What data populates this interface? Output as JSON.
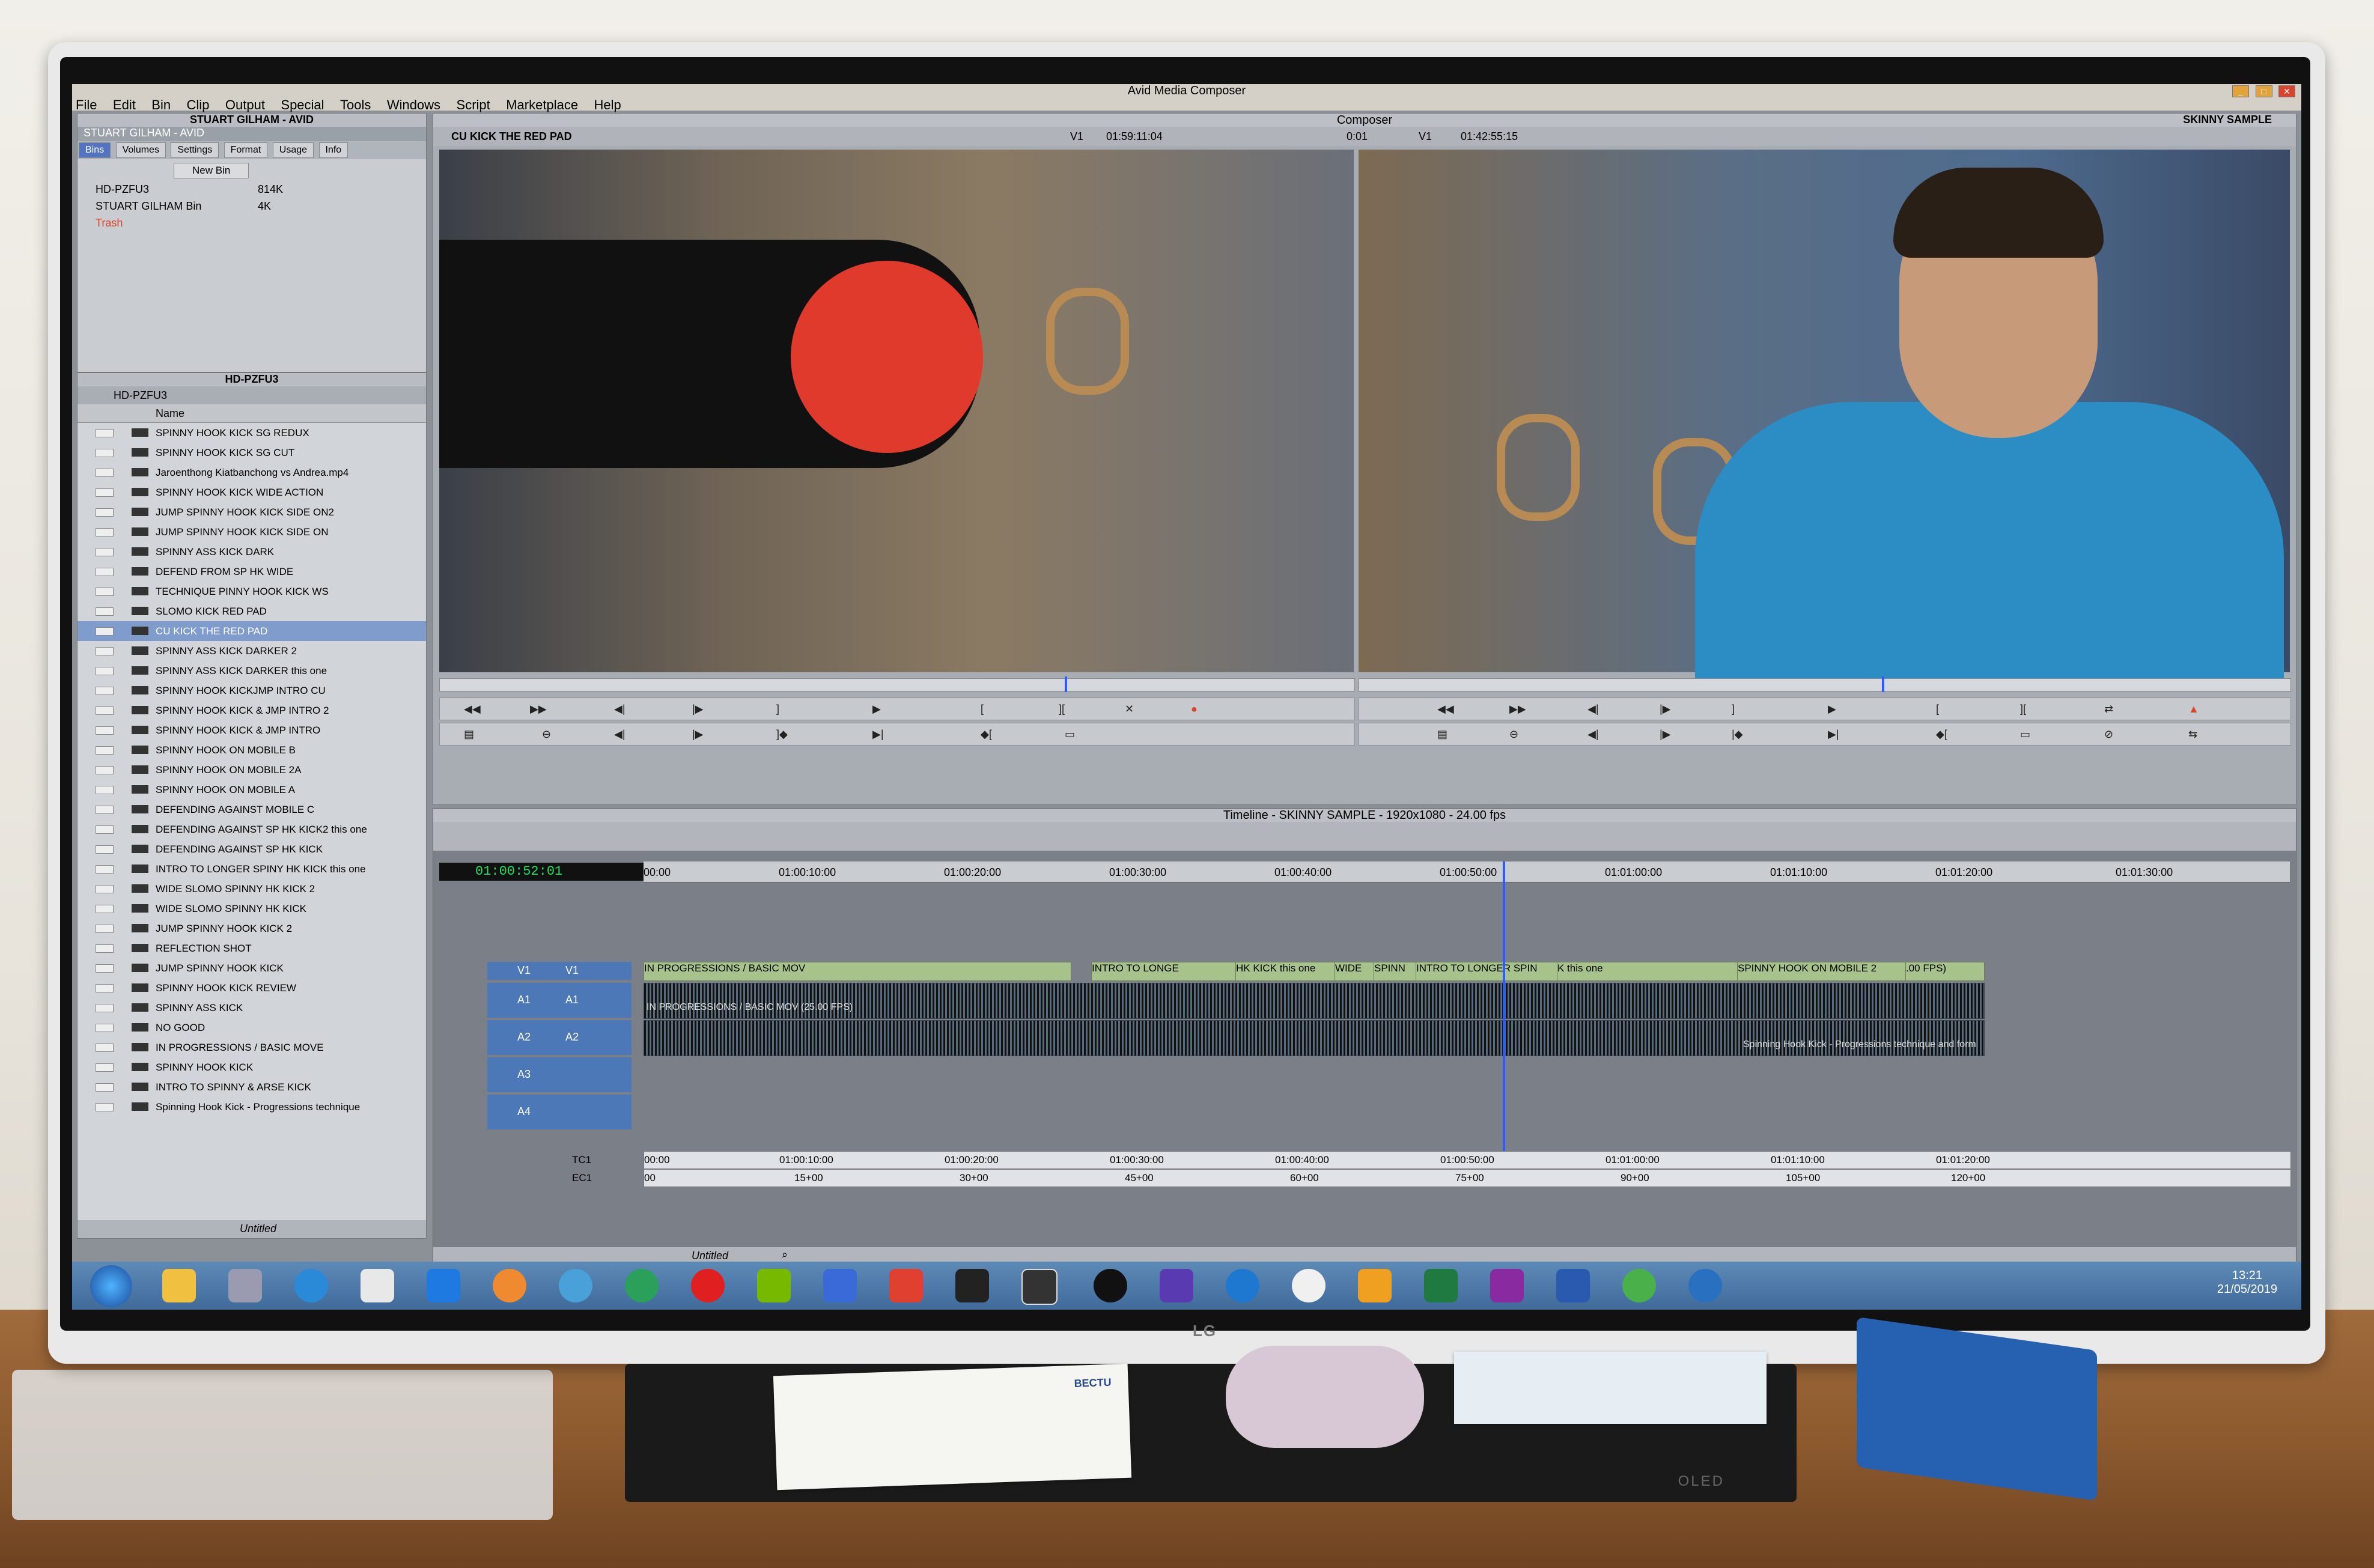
{
  "app": {
    "window_title": "Avid Media Composer",
    "menus": [
      "File",
      "Edit",
      "Bin",
      "Clip",
      "Output",
      "Special",
      "Tools",
      "Windows",
      "Script",
      "Marketplace",
      "Help"
    ]
  },
  "project": {
    "title": "STUART GILHAM - AVID",
    "tab": "STUART GILHAM - AVID",
    "tabs": [
      "Bins",
      "Volumes",
      "Settings",
      "Format",
      "Usage",
      "Info"
    ],
    "new_bin_label": "New Bin",
    "bins": [
      {
        "name": "HD-PZFU3",
        "size": "814K"
      },
      {
        "name": "STUART GILHAM Bin",
        "size": "4K"
      },
      {
        "name": "Trash",
        "size": ""
      }
    ]
  },
  "bin": {
    "title": "HD-PZFU3",
    "tab": "HD-PZFU3",
    "name_header": "Name",
    "view_label": "Untitled",
    "clips": [
      "SPINNY HOOK KICK SG REDUX",
      "SPINNY HOOK KICK SG CUT",
      "Jaroenthong Kiatbanchong vs Andrea.mp4",
      "SPINNY HOOK KICK WIDE ACTION",
      "JUMP SPINNY HOOK KICK SIDE ON2",
      "JUMP SPINNY HOOK KICK SIDE ON",
      "SPINNY ASS KICK DARK",
      "DEFEND FROM SP HK WIDE",
      "TECHNIQUE PINNY HOOK KICK WS",
      "SLOMO KICK RED PAD",
      "CU KICK THE RED PAD",
      "SPINNY ASS KICK DARKER 2",
      "SPINNY ASS KICK DARKER this one",
      "SPINNY HOOK KICKJMP INTRO CU",
      "SPINNY HOOK KICK & JMP INTRO 2",
      "SPINNY HOOK KICK & JMP INTRO",
      "SPINNY HOOK ON MOBILE B",
      "SPINNY HOOK ON MOBILE 2A",
      "SPINNY HOOK ON MOBILE A",
      "DEFENDING AGAINST MOBILE C",
      "DEFENDING AGAINST SP HK KICK2 this one",
      "DEFENDING AGAINST SP HK KICK",
      "INTRO TO LONGER SPINY HK KICK this one",
      "WIDE SLOMO SPINNY HK KICK 2",
      "WIDE SLOMO SPINNY HK KICK",
      "JUMP SPINNY HOOK KICK 2",
      "REFLECTION SHOT",
      "JUMP SPINNY HOOK KICK",
      "SPINNY HOOK KICK REVIEW",
      "SPINNY ASS KICK",
      "NO GOOD",
      "IN PROGRESSIONS / BASIC MOVE",
      "SPINNY HOOK KICK",
      "INTRO TO SPINNY & ARSE KICK",
      "Spinning Hook Kick - Progressions technique"
    ],
    "selected_index": 10
  },
  "composer": {
    "title": "Composer",
    "sequence_name": "SKINNY SAMPLE",
    "source_clip": "CU KICK THE RED PAD",
    "source_track": "V1",
    "source_tc": "01:59:11:04",
    "duration": "0:01",
    "record_track": "V1",
    "record_tc": "01:42:55:15"
  },
  "timeline": {
    "title": "Timeline - SKINNY SAMPLE - 1920x1080 - 24.00 fps",
    "current_tc": "01:00:52:01",
    "ruler": [
      "00:00",
      "01:00:10:00",
      "01:00:20:00",
      "01:00:30:00",
      "01:00:40:00",
      "01:00:50:00",
      "01:01:00:00",
      "01:01:10:00",
      "01:01:20:00",
      "01:01:30:00"
    ],
    "tracks": [
      "V1",
      "A1",
      "A2",
      "A3",
      "A4"
    ],
    "source_tracks": [
      "V1",
      "A1",
      "A2"
    ],
    "v_segments": [
      "IN PROGRESSIONS / BASIC MOV",
      "INTRO TO LONGE",
      "HK KICK this one",
      "WIDE",
      "SPINN",
      "INTRO TO LONGER SPIN",
      "K this one",
      "SPINNY HOOK ON MOBILE 2",
      ".00 FPS)"
    ],
    "a_labels": [
      "IN PROGRESSIONS / BASIC MOV (25.00 FPS)",
      "Spinning Hook Kick - Progressions technique and form"
    ],
    "tc1_label": "TC1",
    "ec1_label": "EC1",
    "tc1_marks": [
      "00:00",
      "01:00:10:00",
      "01:00:20:00",
      "01:00:30:00",
      "01:00:40:00",
      "01:00:50:00",
      "01:01:00:00",
      "01:01:10:00",
      "01:01:20:00"
    ],
    "ec1_marks": [
      "00",
      "15+00",
      "30+00",
      "45+00",
      "60+00",
      "75+00",
      "90+00",
      "105+00",
      "120+00"
    ],
    "footer_label": "Untitled"
  },
  "taskbar": {
    "time": "13:21",
    "date": "21/05/2019"
  },
  "monitor": {
    "brand": "LG",
    "stand_text": "OLED"
  },
  "desk_paper": {
    "header": "BECTU"
  },
  "colors": {
    "accent": "#5574c0",
    "timecode_green": "#1ee05c",
    "pad_red": "#e03a2c",
    "shirt_blue": "#2c8cc4"
  }
}
